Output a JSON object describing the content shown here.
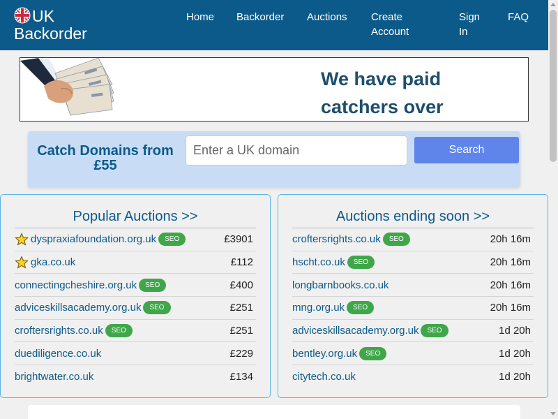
{
  "brand": {
    "line1": "UK",
    "line2": "Backorder"
  },
  "nav": [
    {
      "line1": "Home",
      "line2": ""
    },
    {
      "line1": "Backorder",
      "line2": ""
    },
    {
      "line1": "Auctions",
      "line2": ""
    },
    {
      "line1": "Create",
      "line2": "Account"
    },
    {
      "line1": "Sign",
      "line2": "In"
    },
    {
      "line1": "FAQ",
      "line2": ""
    }
  ],
  "banner": {
    "line1": "We have paid",
    "line2": "catchers over"
  },
  "search": {
    "title": "Catch Domains from £55",
    "placeholder": "Enter a UK domain",
    "button": "Search"
  },
  "popular": {
    "title": "Popular Auctions >>",
    "items": [
      {
        "domain": "dyspraxiafoundation.org.uk",
        "seo": "SEO",
        "price": "£3901",
        "starred": true
      },
      {
        "domain": "gka.co.uk",
        "seo": "",
        "price": "£112",
        "starred": true
      },
      {
        "domain": "connectingcheshire.org.uk",
        "seo": "SEO",
        "price": "£400",
        "starred": false
      },
      {
        "domain": "adviceskillsacademy.org.uk",
        "seo": "SEO",
        "price": "£251",
        "starred": false
      },
      {
        "domain": "croftersrights.co.uk",
        "seo": "SEO",
        "price": "£251",
        "starred": false
      },
      {
        "domain": "duediligence.co.uk",
        "seo": "",
        "price": "£229",
        "starred": false
      },
      {
        "domain": "brightwater.co.uk",
        "seo": "",
        "price": "£134",
        "starred": false
      }
    ]
  },
  "ending": {
    "title": "Auctions ending soon >>",
    "items": [
      {
        "domain": "croftersrights.co.uk",
        "seo": "SEO",
        "time": "20h 16m"
      },
      {
        "domain": "hscht.co.uk",
        "seo": "SEO",
        "time": "20h 16m"
      },
      {
        "domain": "longbarnbooks.co.uk",
        "seo": "",
        "time": "20h 16m"
      },
      {
        "domain": "mng.org.uk",
        "seo": "SEO",
        "time": "20h 16m"
      },
      {
        "domain": "adviceskillsacademy.org.uk",
        "seo": "SEO",
        "time": "1d 20h"
      },
      {
        "domain": "bentley.org.uk",
        "seo": "SEO",
        "time": "1d 20h"
      },
      {
        "domain": "citytech.co.uk",
        "seo": "",
        "time": "1d 20h"
      }
    ]
  },
  "icons": {
    "flag": "uk-flag-icon",
    "star": "star-icon"
  },
  "colors": {
    "navbar": "#0c5a8a",
    "seo_badge": "#3fa64a",
    "search_button": "#5f85ea",
    "panel_border": "#5bb3e6"
  }
}
